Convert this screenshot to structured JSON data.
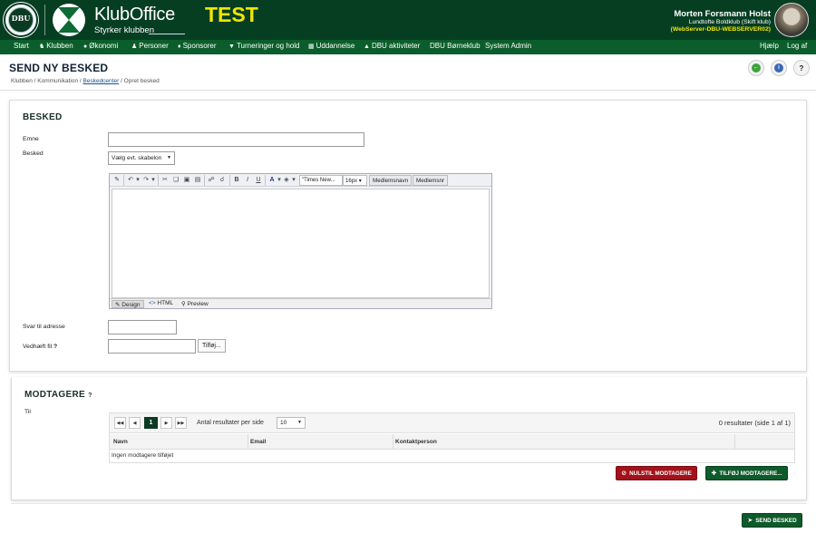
{
  "header": {
    "dbu_logo_text": "DBU",
    "brand_name": "KlubOffice",
    "brand_tagline": "Styrker klubben",
    "environment_badge": "TEST",
    "user_name": "Morten Forsmann Holst",
    "user_club": "Lundtofte Boldklub (Skift klub)",
    "server": "(WebServer-DBU-WEBSERVER02)"
  },
  "nav": {
    "items": [
      {
        "label": "Start",
        "icon": ""
      },
      {
        "label": "Klubben",
        "icon": "users-icon"
      },
      {
        "label": "Økonomi",
        "icon": "money-icon"
      },
      {
        "label": "Personer",
        "icon": "person-icon"
      },
      {
        "label": "Sponsorer",
        "icon": "handshake-icon"
      },
      {
        "label": "Turneringer og hold",
        "icon": "trophy-icon"
      },
      {
        "label": "Uddannelse",
        "icon": "book-icon"
      },
      {
        "label": "DBU aktiviteter",
        "icon": "graduation-cap-icon"
      },
      {
        "label": "DBU Børneklub",
        "icon": ""
      },
      {
        "label": "System Admin",
        "icon": ""
      }
    ],
    "help": "Hjælp",
    "logout": "Log af"
  },
  "page": {
    "title": "SEND NY BESKED",
    "breadcrumb": {
      "part1": "Klubben / Kommunikation / ",
      "link": "Beskedcenter",
      "part2": " / Opret besked"
    }
  },
  "besked": {
    "section_title": "BESKED",
    "subject_label": "Emne",
    "subject_value": "",
    "message_label": "Besked",
    "template_select": "Vælg evt. skabelon",
    "editor": {
      "font": "\"Times New...",
      "size": "16px",
      "field1": "Medlemsnavn",
      "field2": "Medlemsnr",
      "modes": [
        "Design",
        "HTML",
        "Preview"
      ],
      "active_mode": "Design",
      "content": ""
    },
    "reply_label": "Svar til adresse",
    "reply_value": "",
    "attach_label": "Vedhæft fil",
    "attach_help": "?",
    "attach_value": "",
    "attach_button": "Tilføj..."
  },
  "modtagere": {
    "section_title": "MODTAGERE",
    "help": "?",
    "to_label": "Til",
    "pager": {
      "current_page": "1",
      "per_page_label": "Antal resultater per side",
      "per_page_value": "10",
      "info": "0 resultater (side 1 af 1)"
    },
    "columns": [
      "Navn",
      "Email",
      "Kontaktperson"
    ],
    "empty_text": "Ingen modtagere tilføjet",
    "reset_button": "NULSTIL MODTAGERE",
    "add_button": "TILFØJ MODTAGERE..."
  },
  "send_button": "SEND BESKED",
  "colors": {
    "header_bg": "#063e22",
    "nav_bg": "#0b5e2b",
    "test_badge": "#f2e600",
    "danger": "#a3121a",
    "primary": "#0f5a2b"
  }
}
